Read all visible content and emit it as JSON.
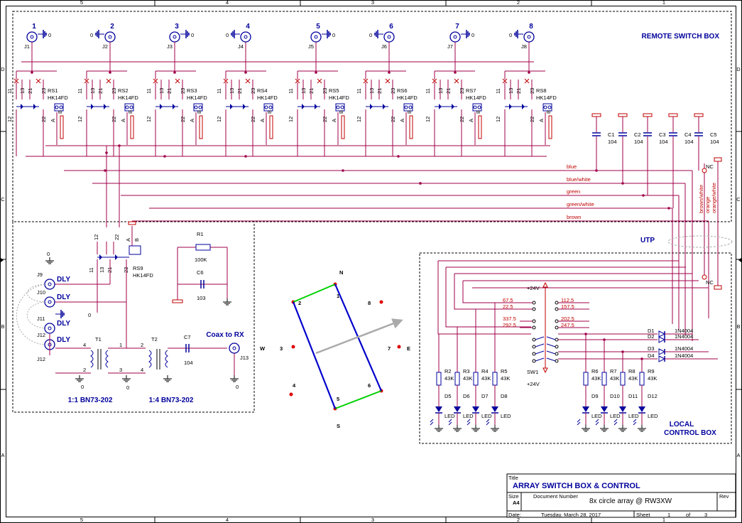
{
  "border": {
    "cols": [
      "5",
      "4",
      "3",
      "2",
      "1"
    ],
    "rows": [
      "D",
      "C",
      "B",
      "A"
    ]
  },
  "remote_box": {
    "title": "REMOTE SWITCH BOX"
  },
  "local_box": {
    "title_line1": "LOCAL",
    "title_line2": "CONTROL BOX"
  },
  "connectors_top": [
    {
      "num": "1",
      "ref": "J1"
    },
    {
      "num": "2",
      "ref": "J2"
    },
    {
      "num": "3",
      "ref": "J3"
    },
    {
      "num": "4",
      "ref": "J4"
    },
    {
      "num": "5",
      "ref": "J5"
    },
    {
      "num": "6",
      "ref": "J6"
    },
    {
      "num": "7",
      "ref": "J7"
    },
    {
      "num": "8",
      "ref": "J8"
    }
  ],
  "relays": [
    {
      "ref": "RS1",
      "part": "HK14FD"
    },
    {
      "ref": "RS2",
      "part": "HK14FD"
    },
    {
      "ref": "RS3",
      "part": "HK14FD"
    },
    {
      "ref": "RS4",
      "part": "HK14FD"
    },
    {
      "ref": "RS5",
      "part": "HK14FD"
    },
    {
      "ref": "RS6",
      "part": "HK14FD"
    },
    {
      "ref": "RS7",
      "part": "HK14FD"
    },
    {
      "ref": "RS8",
      "part": "HK14FD"
    }
  ],
  "relay9": {
    "ref": "RS9",
    "part": "HK14FD"
  },
  "relay_pins": {
    "p11": "11",
    "p13": "13",
    "p21": "21",
    "p23": "23",
    "p12": "12",
    "p22": "22",
    "pa": "A",
    "pb": "B"
  },
  "zero": "0",
  "caps": [
    {
      "ref": "C1",
      "val": "104"
    },
    {
      "ref": "C2",
      "val": "104"
    },
    {
      "ref": "C3",
      "val": "104"
    },
    {
      "ref": "C4",
      "val": "104"
    },
    {
      "ref": "C5",
      "val": "104"
    }
  ],
  "wires": [
    "blue",
    "blue/white",
    "green",
    "green/white",
    "brown"
  ],
  "wires_vertical": [
    "brown/white",
    "orange",
    "orange/white"
  ],
  "nc": "NC",
  "utp": "UTP",
  "r1": {
    "ref": "R1",
    "val": "100K"
  },
  "c6": {
    "ref": "C6",
    "val": "103"
  },
  "c7": {
    "ref": "C7",
    "val": "104"
  },
  "dly_jacks": [
    {
      "ref": "J9",
      "label": "DLY"
    },
    {
      "ref": "J10",
      "label": "DLY"
    },
    {
      "ref": "J11",
      "label": "DLY"
    },
    {
      "ref": "J12",
      "label": "DLY"
    }
  ],
  "j13": "J13",
  "coax_label": "Coax to RX",
  "t1": {
    "ref": "T1",
    "ratio": "1:1  BN73-202",
    "pins": [
      "4",
      "2",
      "1",
      "3"
    ]
  },
  "t2": {
    "ref": "T2",
    "ratio": "1:4  BN73-202",
    "pins": [
      "1",
      "2",
      "3",
      "4"
    ]
  },
  "compass": {
    "n": "N",
    "s": "S",
    "w": "W",
    "e": "E",
    "nums": [
      "1",
      "2",
      "3",
      "4",
      "5",
      "6",
      "7",
      "8"
    ]
  },
  "switch": {
    "ref": "SW1",
    "vplus_top": "+24V",
    "vplus_bot": "+24V",
    "left_labels": [
      "67.5",
      "22.5",
      "337.5",
      "292.5"
    ],
    "right_labels": [
      "112.5",
      "157.5",
      "202.5",
      "247.5"
    ]
  },
  "resistors_left": [
    {
      "ref": "R2",
      "val": "43K"
    },
    {
      "ref": "R3",
      "val": "43K"
    },
    {
      "ref": "R4",
      "val": "43K"
    },
    {
      "ref": "R5",
      "val": "43K"
    }
  ],
  "resistors_right": [
    {
      "ref": "R6",
      "val": "43K"
    },
    {
      "ref": "R7",
      "val": "43K"
    },
    {
      "ref": "R8",
      "val": "43K"
    },
    {
      "ref": "R9",
      "val": "43K"
    }
  ],
  "leds_left": [
    "D5",
    "D6",
    "D7",
    "D8"
  ],
  "leds_right": [
    "D9",
    "D10",
    "D11",
    "D12"
  ],
  "led_label": "LED",
  "diodes": [
    {
      "ref": "D1",
      "part": "1N4004"
    },
    {
      "ref": "D2",
      "part": "1N4004"
    },
    {
      "ref": "D3",
      "part": "1N4004"
    },
    {
      "ref": "D4",
      "part": "1N4004"
    }
  ],
  "title_block": {
    "title_label": "Title",
    "title": "ARRAY SWITCH BOX & CONTROL",
    "size_label": "Size",
    "size": "A4",
    "docnum_label": "Document  Number",
    "docnum": "8x circle array @ RW3XW",
    "rev_label": "Rev",
    "date_label": "Date:",
    "date": "Tuesday, March 28, 2017",
    "sheet_label": "Sheet",
    "sheet": "1",
    "of_label": "of",
    "of": "3"
  },
  "colors": {
    "wire": "#a0004a",
    "comp": "#00009c",
    "red": "#c00000",
    "green": "#00d000",
    "blue": "#0000cc",
    "grey": "#aaaaaa"
  }
}
